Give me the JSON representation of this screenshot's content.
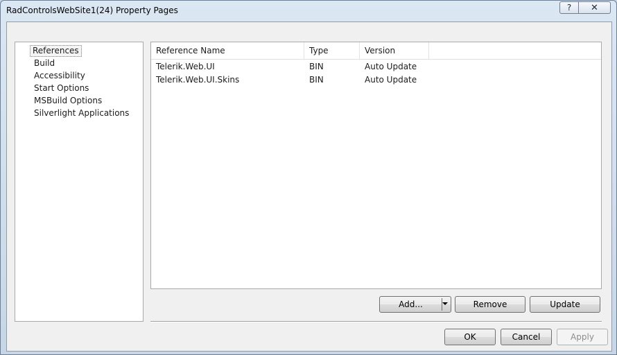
{
  "window": {
    "title": "RadControlsWebSite1(24) Property Pages",
    "help_glyph": "?",
    "close_glyph": "✕"
  },
  "nav": {
    "items": [
      {
        "label": "References",
        "selected": true
      },
      {
        "label": "Build",
        "selected": false
      },
      {
        "label": "Accessibility",
        "selected": false
      },
      {
        "label": "Start Options",
        "selected": false
      },
      {
        "label": "MSBuild Options",
        "selected": false
      },
      {
        "label": "Silverlight Applications",
        "selected": false
      }
    ]
  },
  "references": {
    "columns": [
      "Reference Name",
      "Type",
      "Version"
    ],
    "rows": [
      [
        "Telerik.Web.UI",
        "BIN",
        "Auto Update"
      ],
      [
        "Telerik.Web.UI.Skins",
        "BIN",
        "Auto Update"
      ]
    ]
  },
  "actions": {
    "add_label": "Add...",
    "remove_label": "Remove",
    "update_label": "Update"
  },
  "dialog": {
    "ok_label": "OK",
    "cancel_label": "Cancel",
    "apply_label": "Apply"
  }
}
